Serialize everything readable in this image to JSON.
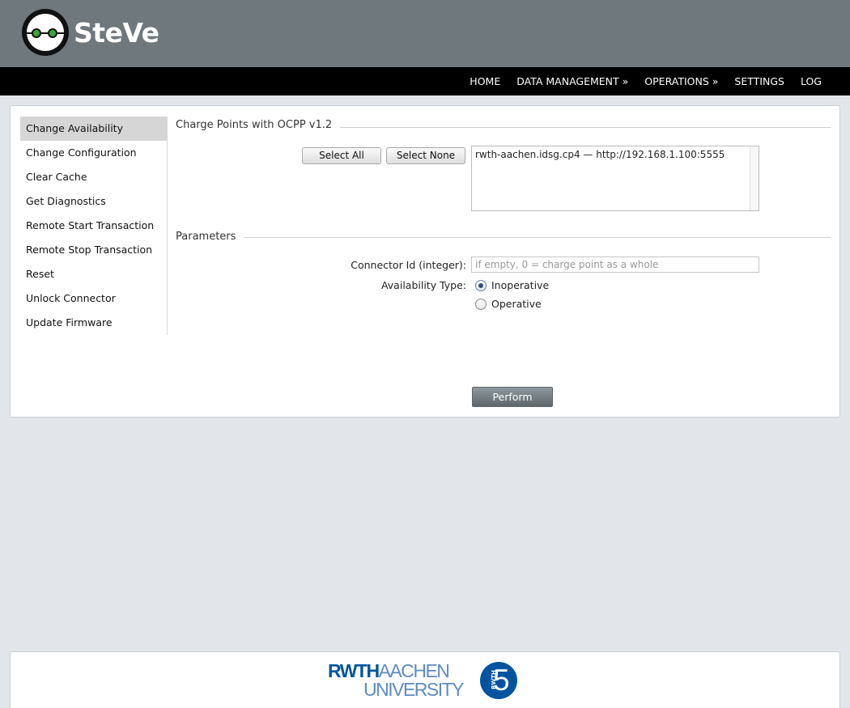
{
  "header": {
    "app_name": "SteVe"
  },
  "nav": {
    "items": [
      "HOME",
      "DATA MANAGEMENT »",
      "OPERATIONS »",
      "SETTINGS",
      "LOG"
    ]
  },
  "sidebar": {
    "items": [
      {
        "label": "Change Availability",
        "active": true
      },
      {
        "label": "Change Configuration"
      },
      {
        "label": "Clear Cache"
      },
      {
        "label": "Get Diagnostics"
      },
      {
        "label": "Remote Start Transaction"
      },
      {
        "label": "Remote Stop Transaction"
      },
      {
        "label": "Reset"
      },
      {
        "label": "Unlock Connector"
      },
      {
        "label": "Update Firmware"
      }
    ]
  },
  "charge_points": {
    "title": "Charge Points with OCPP v1.2",
    "select_all_label": "Select All",
    "select_none_label": "Select None",
    "options": [
      "rwth-aachen.idsg.cp4 — http://192.168.1.100:5555"
    ]
  },
  "parameters": {
    "title": "Parameters",
    "connector_label": "Connector Id (integer):",
    "connector_placeholder": "if empty, 0 = charge point as a whole",
    "availability_label": "Availability Type:",
    "availability_options": [
      {
        "label": "Inoperative",
        "checked": true
      },
      {
        "label": "Operative",
        "checked": false
      }
    ]
  },
  "actions": {
    "perform_label": "Perform"
  },
  "footer": {
    "university_line1_bold": "RWTH",
    "university_line1_light": "AACHEN",
    "university_line2": "UNIVERSITY",
    "badge_small": "RWTH",
    "badge_number": "5"
  },
  "colors": {
    "header_bg": "#6f787d",
    "nav_bg": "#000000",
    "rwth_blue": "#00549f"
  }
}
